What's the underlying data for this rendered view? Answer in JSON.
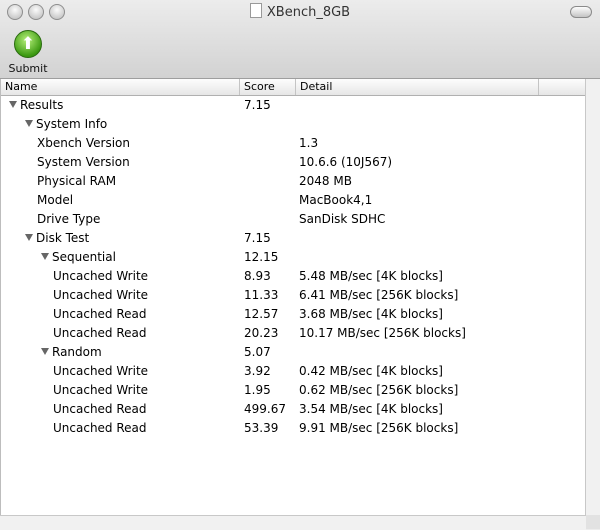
{
  "window": {
    "title": "XBench_8GB"
  },
  "toolbar": {
    "submit_label": "Submit"
  },
  "columns": [
    "Name",
    "Score",
    "Detail"
  ],
  "rows": [
    {
      "name": "Results",
      "score": "7.15",
      "detail": "",
      "level": 0,
      "expanded": true
    },
    {
      "name": "System Info",
      "score": "",
      "detail": "",
      "level": 1,
      "expanded": true
    },
    {
      "name": "Xbench Version",
      "score": "",
      "detail": "1.3",
      "level": 2
    },
    {
      "name": "System Version",
      "score": "",
      "detail": "10.6.6 (10J567)",
      "level": 2
    },
    {
      "name": "Physical RAM",
      "score": "",
      "detail": "2048 MB",
      "level": 2
    },
    {
      "name": "Model",
      "score": "",
      "detail": "MacBook4,1",
      "level": 2
    },
    {
      "name": "Drive Type",
      "score": "",
      "detail": "SanDisk SDHC",
      "level": 2
    },
    {
      "name": "Disk Test",
      "score": "7.15",
      "detail": "",
      "level": 1,
      "expanded": true
    },
    {
      "name": "Sequential",
      "score": "12.15",
      "detail": "",
      "level": 2,
      "expanded": true
    },
    {
      "name": "Uncached Write",
      "score": "8.93",
      "detail": "5.48 MB/sec [4K blocks]",
      "level": 3
    },
    {
      "name": "Uncached Write",
      "score": "11.33",
      "detail": "6.41 MB/sec [256K blocks]",
      "level": 3
    },
    {
      "name": "Uncached Read",
      "score": "12.57",
      "detail": "3.68 MB/sec [4K blocks]",
      "level": 3
    },
    {
      "name": "Uncached Read",
      "score": "20.23",
      "detail": "10.17 MB/sec [256K blocks]",
      "level": 3
    },
    {
      "name": "Random",
      "score": "5.07",
      "detail": "",
      "level": 2,
      "expanded": true
    },
    {
      "name": "Uncached Write",
      "score": "3.92",
      "detail": "0.42 MB/sec [4K blocks]",
      "level": 3
    },
    {
      "name": "Uncached Write",
      "score": "1.95",
      "detail": "0.62 MB/sec [256K blocks]",
      "level": 3
    },
    {
      "name": "Uncached Read",
      "score": "499.67",
      "detail": "3.54 MB/sec [4K blocks]",
      "level": 3
    },
    {
      "name": "Uncached Read",
      "score": "53.39",
      "detail": "9.91 MB/sec [256K blocks]",
      "level": 3
    }
  ]
}
